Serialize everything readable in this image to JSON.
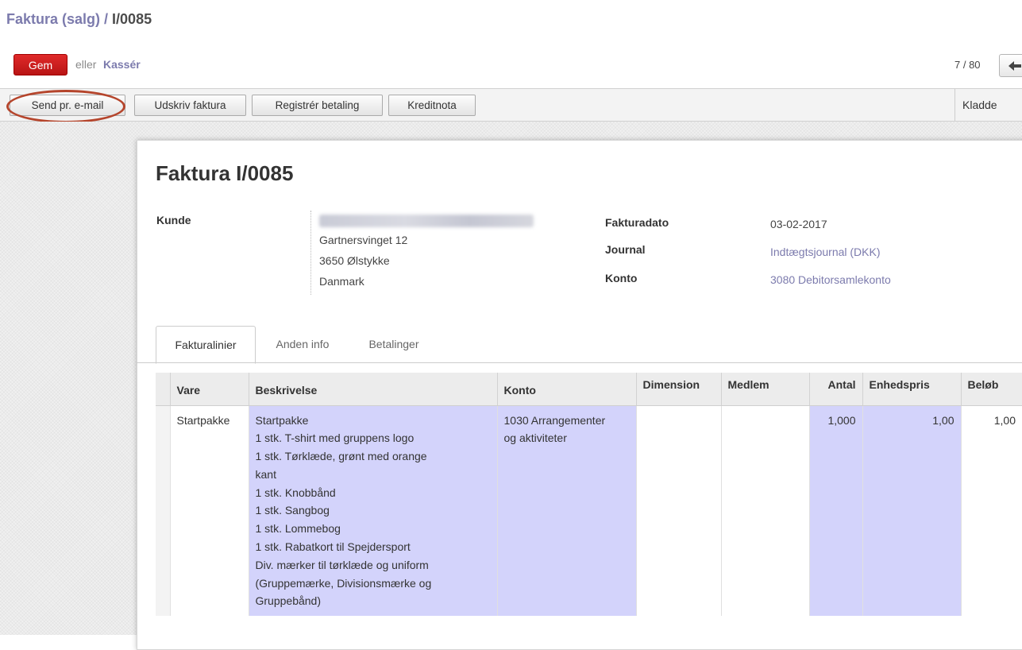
{
  "breadcrumb": {
    "parent": "Faktura (salg)",
    "separator": " / ",
    "current": "I/0085"
  },
  "actions": {
    "save_label": "Gem",
    "or_label": "eller",
    "discard_label": "Kassér"
  },
  "pager": {
    "text": "7 / 80"
  },
  "toolbar": {
    "buttons": [
      "Send pr. e-mail",
      "Udskriv faktura",
      "Registrér betaling",
      "Kreditnota"
    ],
    "status": "Kladde"
  },
  "invoice": {
    "title": "Faktura I/0085",
    "customer_label": "Kunde",
    "address": [
      "Gartnersvinget 12",
      "3650 Ølstykke",
      "Danmark"
    ],
    "date_label": "Fakturadato",
    "date_value": "03-02-2017",
    "journal_label": "Journal",
    "journal_value": "Indtægtsjournal (DKK)",
    "account_label": "Konto",
    "account_value": "3080 Debitorsamlekonto"
  },
  "tabs": [
    "Fakturalinier",
    "Anden info",
    "Betalinger"
  ],
  "table": {
    "headers": [
      "Vare",
      "Beskrivelse",
      "Konto",
      "Dimension",
      "Medlem",
      "Antal",
      "Enhedspris",
      "Beløb"
    ],
    "rows": [
      {
        "vare": "Startpakke",
        "description": [
          "Startpakke",
          "1 stk. T-shirt med gruppens logo",
          "1 stk. Tørklæde, grønt med orange",
          "kant",
          "1 stk. Knobbånd",
          "1 stk. Sangbog",
          "1 stk. Lommebog",
          "1 stk. Rabatkort til Spejdersport",
          "Div. mærker til tørklæde og uniform",
          "(Gruppemærke, Divisionsmærke og",
          "Gruppebånd)"
        ],
        "konto": [
          "1030 Arrangementer",
          "og aktiviteter"
        ],
        "dimension": "",
        "medlem": "",
        "antal": "1,000",
        "enhedspris": "1,00",
        "beloeb": "1,00"
      }
    ]
  }
}
